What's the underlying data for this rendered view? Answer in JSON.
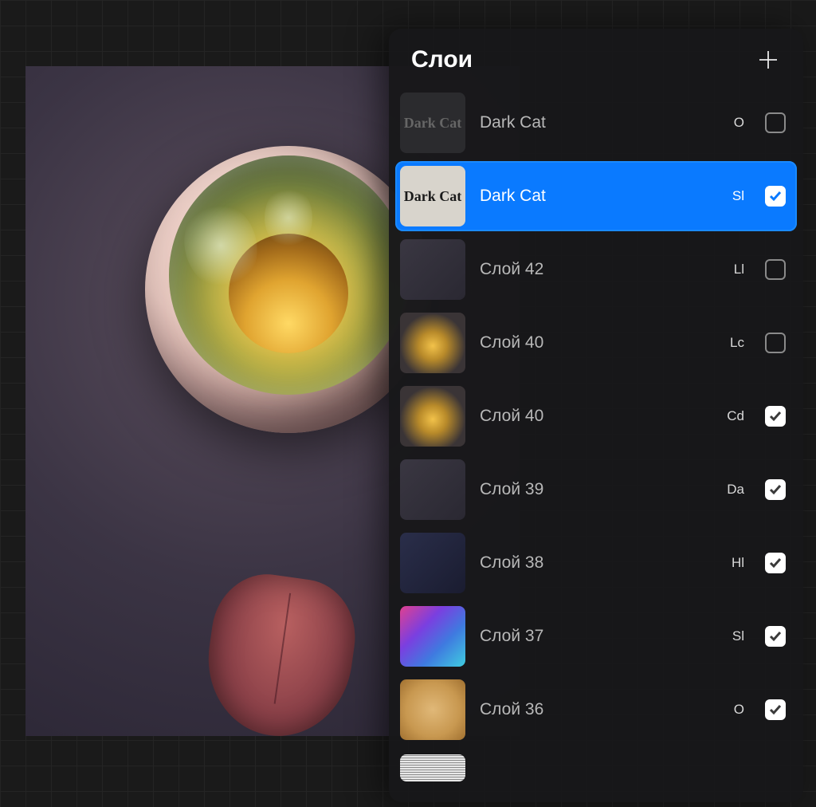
{
  "panel": {
    "title": "Слои"
  },
  "layers": [
    {
      "name": "Dark Cat",
      "blend": "O",
      "visible": false,
      "selected": false,
      "thumb": "text-gray"
    },
    {
      "name": "Dark Cat",
      "blend": "Sl",
      "visible": true,
      "selected": true,
      "thumb": "text-dark"
    },
    {
      "name": "Слой 42",
      "blend": "Ll",
      "visible": false,
      "selected": false,
      "thumb": "dim"
    },
    {
      "name": "Слой 40",
      "blend": "Lc",
      "visible": false,
      "selected": false,
      "thumb": "glow"
    },
    {
      "name": "Слой 40",
      "blend": "Cd",
      "visible": true,
      "selected": false,
      "thumb": "glow"
    },
    {
      "name": "Слой 39",
      "blend": "Da",
      "visible": true,
      "selected": false,
      "thumb": "dim"
    },
    {
      "name": "Слой 38",
      "blend": "Hl",
      "visible": true,
      "selected": false,
      "thumb": "navy"
    },
    {
      "name": "Слой 37",
      "blend": "Sl",
      "visible": true,
      "selected": false,
      "thumb": "rainbow"
    },
    {
      "name": "Слой 36",
      "blend": "O",
      "visible": true,
      "selected": false,
      "thumb": "parchment"
    }
  ],
  "thumb_text": "Dark Cat"
}
